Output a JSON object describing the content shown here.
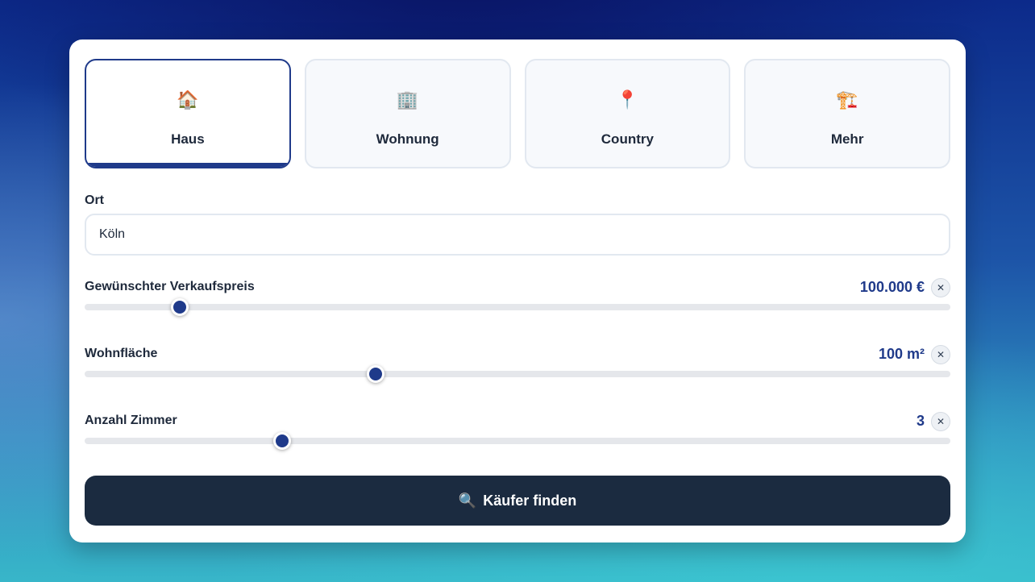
{
  "property_types": [
    {
      "icon": "🏠",
      "icon_name": "house-icon",
      "label": "Haus",
      "active": true
    },
    {
      "icon": "🏢",
      "icon_name": "apartment-building-icon",
      "label": "Wohnung",
      "active": false
    },
    {
      "icon": "📍",
      "icon_name": "location-pin-icon",
      "label": "Country",
      "active": false
    },
    {
      "icon": "🏗️",
      "icon_name": "construction-crane-icon",
      "label": "Mehr",
      "active": false
    }
  ],
  "location": {
    "label": "Ort",
    "value": "Köln"
  },
  "price": {
    "label": "Gewünschter Verkaufspreis",
    "value": "100.000 €",
    "clear": "✕",
    "fill_percent": 11
  },
  "area": {
    "label": "Wohnfläche",
    "value": "100 m²",
    "clear": "✕",
    "fill_percent": 33.6
  },
  "rooms": {
    "label": "Anzahl Zimmer",
    "value": "3",
    "clear": "✕",
    "fill_percent": 22.8
  },
  "submit": {
    "icon": "🔍",
    "icon_name": "search-icon",
    "label": "Käufer finden"
  },
  "colors": {
    "accent": "#1f3a8a",
    "button": "#1b2b40"
  }
}
